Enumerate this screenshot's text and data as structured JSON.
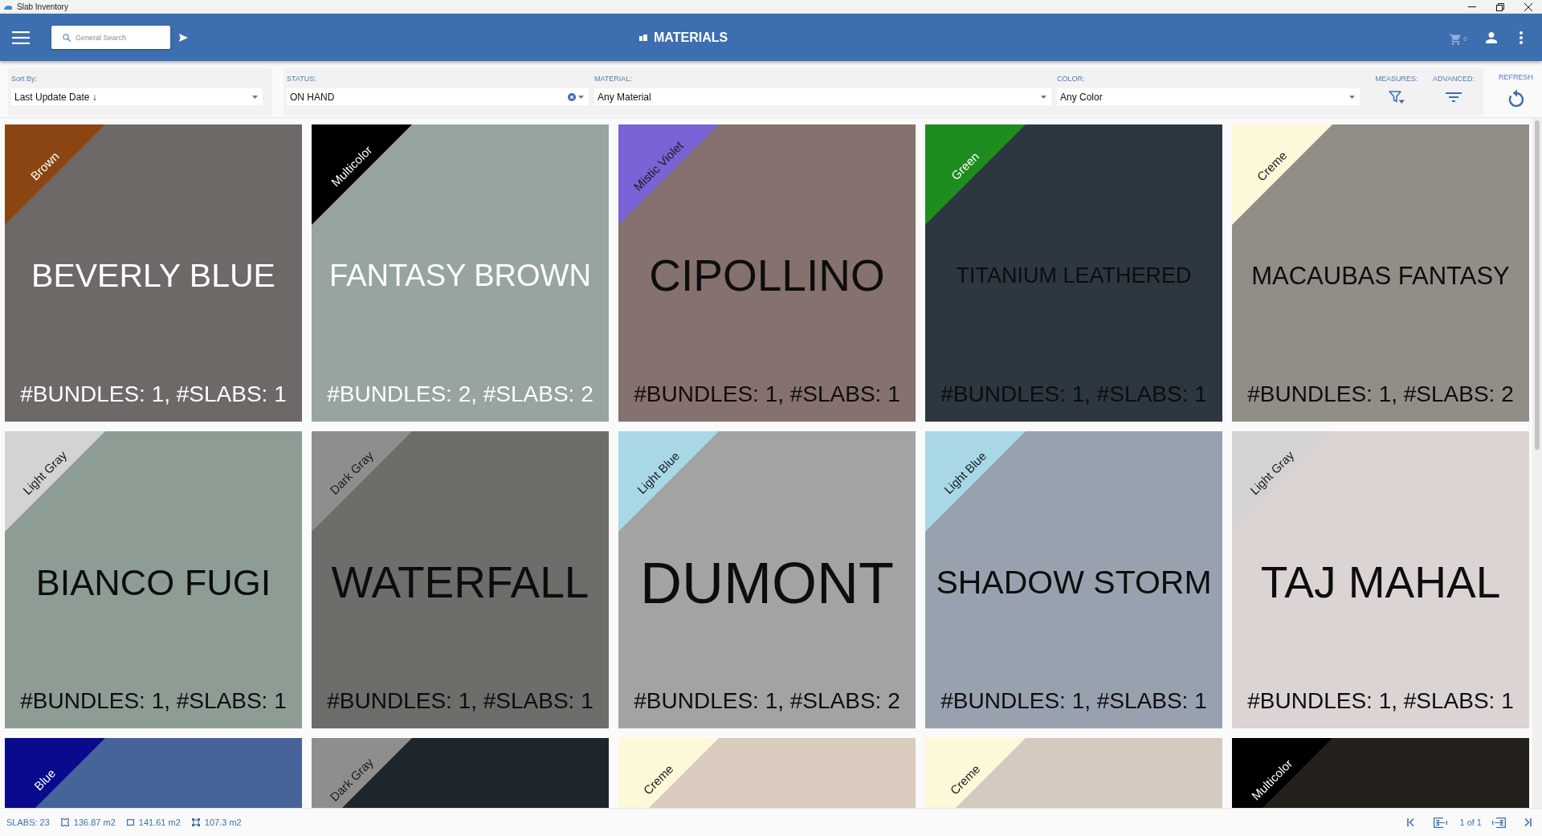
{
  "window": {
    "title": "Slab Inventory"
  },
  "header": {
    "search": {
      "placeholder": "General Search"
    },
    "title": "MATERIALS",
    "cart": {
      "count": "0",
      "disabled": true
    }
  },
  "filters": {
    "sort_by": {
      "label": "Sort By:",
      "value": "Last Update Date ↓",
      "clearable": false
    },
    "status": {
      "label": "STATUS:",
      "value": "ON HAND",
      "clearable": true
    },
    "material": {
      "label": "MATERIAL:",
      "value": "Any Material",
      "clearable": false
    },
    "color": {
      "label": "COLOR:",
      "value": "Any Color",
      "clearable": false
    },
    "measures": {
      "label": "MEASURES:"
    },
    "advanced": {
      "label": "ADVANCED:"
    },
    "refresh": {
      "label": "REFRESH"
    }
  },
  "tiles": [
    {
      "name": "BEVERLY BLUE",
      "counts": "#BUNDLES: 1, #SLABS: 1",
      "light_text": true,
      "photo": {
        "color": "#6e6866"
      },
      "tag": {
        "label": "Brown",
        "color": "#8b4513"
      }
    },
    {
      "name": "FANTASY BROWN",
      "counts": "#BUNDLES: 2, #SLABS: 2",
      "light_text": true,
      "photo": {
        "color": "#97a4a2"
      },
      "tag": {
        "label": "Multicolor",
        "color": "#000000"
      }
    },
    {
      "name": "CIPOLLINO",
      "counts": "#BUNDLES: 1, #SLABS: 1",
      "light_text": false,
      "photo": {
        "color": "#85716e"
      },
      "tag": {
        "label": "Mistic Violet",
        "color": "#7b62d6"
      }
    },
    {
      "name": "TITANIUM LEATHERED",
      "counts": "#BUNDLES: 1, #SLABS: 1",
      "light_text": false,
      "photo": {
        "color": "#2c3741"
      },
      "tag": {
        "label": "Green",
        "color": "#1e8c1e"
      }
    },
    {
      "name": "MACAUBAS FANTASY",
      "counts": "#BUNDLES: 1, #SLABS: 2",
      "light_text": false,
      "photo": {
        "color": "#928d87"
      },
      "tag": {
        "label": "Creme",
        "color": "#fdf8d8"
      }
    },
    {
      "name": "BIANCO FUGI",
      "counts": "#BUNDLES: 1, #SLABS: 1",
      "light_text": false,
      "photo": {
        "color": "#8e9d93"
      },
      "tag": {
        "label": "Light Gray",
        "color": "#d3d3d3"
      }
    },
    {
      "name": "WATERFALL",
      "counts": "#BUNDLES: 1, #SLABS: 1",
      "light_text": false,
      "photo": {
        "color": "#6e6d69"
      },
      "tag": {
        "label": "Dark Gray",
        "color": "#8e8e8e"
      }
    },
    {
      "name": "DUMONT",
      "counts": "#BUNDLES: 1, #SLABS: 2",
      "light_text": false,
      "photo": {
        "color": "#a2a4a3"
      },
      "tag": {
        "label": "Light Blue",
        "color": "#a8d8e6"
      }
    },
    {
      "name": "SHADOW STORM",
      "counts": "#BUNDLES: 1, #SLABS: 1",
      "light_text": false,
      "photo": {
        "color": "#98a2ae"
      },
      "tag": {
        "label": "Light Blue",
        "color": "#a8d8e6"
      }
    },
    {
      "name": "TAJ MAHAL",
      "counts": "#BUNDLES: 1, #SLABS: 1",
      "light_text": false,
      "photo": {
        "color": "#dcd4d2"
      },
      "tag": {
        "label": "Light Gray",
        "color": "#d3d3d3"
      }
    },
    {
      "photo": {
        "color": "#46639a"
      },
      "tag": {
        "label": "Blue",
        "color": "#0a0a8c"
      }
    },
    {
      "photo": {
        "color": "#1d252d"
      },
      "tag": {
        "label": "Dark Gray",
        "color": "#8e8e8e"
      }
    },
    {
      "photo": {
        "color": "#d9cbbd"
      },
      "tag": {
        "label": "Creme",
        "color": "#fdf8d8"
      }
    },
    {
      "photo": {
        "color": "#d5cac0"
      },
      "tag": {
        "label": "Creme",
        "color": "#fdf8d8"
      }
    },
    {
      "photo": {
        "color": "#24211d"
      },
      "tag": {
        "label": "Multicolor",
        "color": "#000000"
      }
    }
  ],
  "status_bar": {
    "slabs": "SLABS: 23",
    "areas": [
      {
        "kind": "pinched",
        "value": "136.87 m2"
      },
      {
        "kind": "plain",
        "value": "141.61 m2"
      },
      {
        "kind": "cornered",
        "value": "107.3 m2"
      }
    ],
    "page": "1 of 1"
  }
}
